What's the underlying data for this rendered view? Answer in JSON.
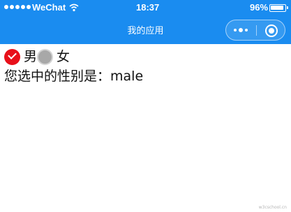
{
  "status_bar": {
    "carrier": "WeChat",
    "time": "18:37",
    "battery_percent": "96%",
    "battery_level": 0.96,
    "wifi_icon": "wifi-icon"
  },
  "nav": {
    "title": "我的应用",
    "more_icon": "more-dots-icon",
    "close_icon": "target-circle-icon",
    "bar_color": "#1a8cf0"
  },
  "gender": {
    "options": [
      {
        "label": "男",
        "checked": true
      },
      {
        "label": "女",
        "checked": false
      }
    ],
    "result_prefix": "您选中的性别是：",
    "result_value": "male",
    "checked_color": "#e8101a"
  },
  "watermark": "w3cschool.cn"
}
